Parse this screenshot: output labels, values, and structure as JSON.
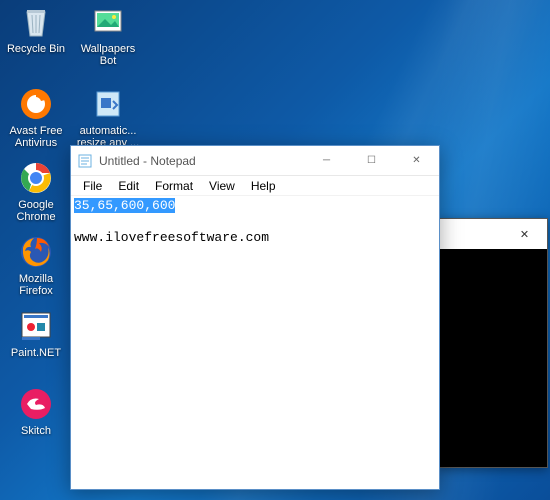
{
  "desktop": {
    "icons_col1": [
      {
        "label": "Recycle Bin",
        "name": "recycle-bin-icon"
      },
      {
        "label": "Avast Free Antivirus",
        "name": "avast-icon"
      },
      {
        "label": "Google Chrome",
        "name": "chrome-icon"
      },
      {
        "label": "Mozilla Firefox",
        "name": "firefox-icon"
      },
      {
        "label": "Paint.NET",
        "name": "paintnet-icon"
      },
      {
        "label": "Skitch",
        "name": "skitch-icon"
      }
    ],
    "icons_col2": [
      {
        "label": "Wallpapers Bot",
        "name": "wallpapersbot-icon"
      },
      {
        "label": "automatic... resize any ...",
        "name": "file-icon"
      }
    ]
  },
  "notepad": {
    "title": "Untitled - Notepad",
    "menu": {
      "file": "File",
      "edit": "Edit",
      "format": "Format",
      "view": "View",
      "help": "Help"
    },
    "content_selected": "35,65,600,600",
    "content_line2": "www.ilovefreesoftware.com"
  },
  "back_window": {
    "close_glyph": "✕"
  },
  "win_controls": {
    "min": "─",
    "max": "☐",
    "close": "✕"
  }
}
